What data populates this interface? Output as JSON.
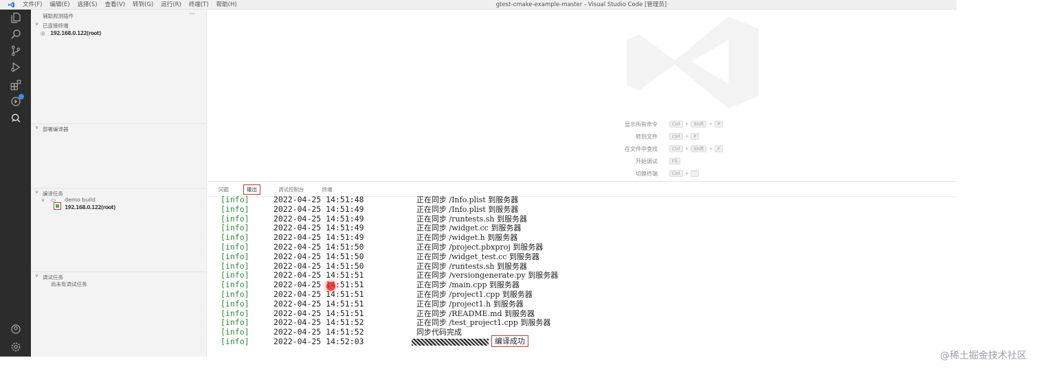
{
  "window": {
    "title": "gtest-cmake-example-master - Visual Studio Code [管理员]",
    "menu": [
      "文件(F)",
      "编辑(E)",
      "选择(S)",
      "查看(V)",
      "转到(G)",
      "运行(R)",
      "终端(T)",
      "帮助(H)"
    ]
  },
  "sidebar": {
    "header": "辅助观测插件",
    "more": "···",
    "section1_title": "已连接终端",
    "section1_item": "192.168.0.122(root)",
    "section2_title": "部署编译器",
    "section3_title": "编译任务",
    "task_name": "demo build",
    "task_item": "192.168.0.122(root)",
    "section4_title": "调试任务",
    "no_debug_task": "尚未有调试任务"
  },
  "welcome": {
    "shortcuts": [
      {
        "label": "显示所有命令",
        "keys": [
          "Ctrl",
          "Shift",
          "P"
        ]
      },
      {
        "label": "转到文件",
        "keys": [
          "Ctrl",
          "P"
        ]
      },
      {
        "label": "在文件中查找",
        "keys": [
          "Ctrl",
          "Shift",
          "F"
        ]
      },
      {
        "label": "开始调试",
        "keys": [
          "F5"
        ]
      },
      {
        "label": "切换终端",
        "keys": [
          "Ctrl",
          "`"
        ]
      }
    ]
  },
  "panel": {
    "tabs": [
      "问题",
      "输出",
      "调试控制台",
      "终端"
    ],
    "active_tab": "输出",
    "lines": [
      {
        "level": "[info]",
        "time": "2022-04-25 14:51:48",
        "msg": "正在同步 /Info.plist 到服务器"
      },
      {
        "level": "[info]",
        "time": "2022-04-25 14:51:49",
        "msg": "正在同步 /Info.plist 到服务器"
      },
      {
        "level": "[info]",
        "time": "2022-04-25 14:51:49",
        "msg": "正在同步 /runtests.sh 到服务器"
      },
      {
        "level": "[info]",
        "time": "2022-04-25 14:51:49",
        "msg": "正在同步 /widget.cc 到服务器"
      },
      {
        "level": "[info]",
        "time": "2022-04-25 14:51:49",
        "msg": "正在同步 /widget.h 到服务器"
      },
      {
        "level": "[info]",
        "time": "2022-04-25 14:51:50",
        "msg": "正在同步 /project.pbxproj 到服务器"
      },
      {
        "level": "[info]",
        "time": "2022-04-25 14:51:50",
        "msg": "正在同步 /widget_test.cc 到服务器"
      },
      {
        "level": "[info]",
        "time": "2022-04-25 14:51:50",
        "msg": "正在同步 /runtests.sh 到服务器"
      },
      {
        "level": "[info]",
        "time": "2022-04-25 14:51:51",
        "msg": "正在同步 /versiongenerate.py 到服务器"
      },
      {
        "level": "[info]",
        "time": "2022-04-25 14:51:51",
        "msg": "正在同步 /main.cpp 到服务器"
      },
      {
        "level": "[info]",
        "time": "2022-04-25 14:51:51",
        "msg": "正在同步 /project1.cpp 到服务器"
      },
      {
        "level": "[info]",
        "time": "2022-04-25 14:51:51",
        "msg": "正在同步 /project1.h 到服务器"
      },
      {
        "level": "[info]",
        "time": "2022-04-25 14:51:51",
        "msg": "正在同步 /README.md 到服务器"
      },
      {
        "level": "[info]",
        "time": "2022-04-25 14:51:52",
        "msg": "正在同步 /test_project1.cpp 到服务器"
      },
      {
        "level": "[info]",
        "time": "2022-04-25 14:51:52",
        "msg": "同步代码完成"
      }
    ],
    "last_line": {
      "level": "[info]",
      "time": "2022-04-25 14:52:03",
      "result": "编译成功"
    }
  },
  "watermark": "@稀土掘金技术社区",
  "colors": {
    "activity_bar": "#2c2c2c",
    "info_green": "#2e8b3a",
    "highlight_red": "#c0392b",
    "badge_blue": "#3c8ce6"
  }
}
